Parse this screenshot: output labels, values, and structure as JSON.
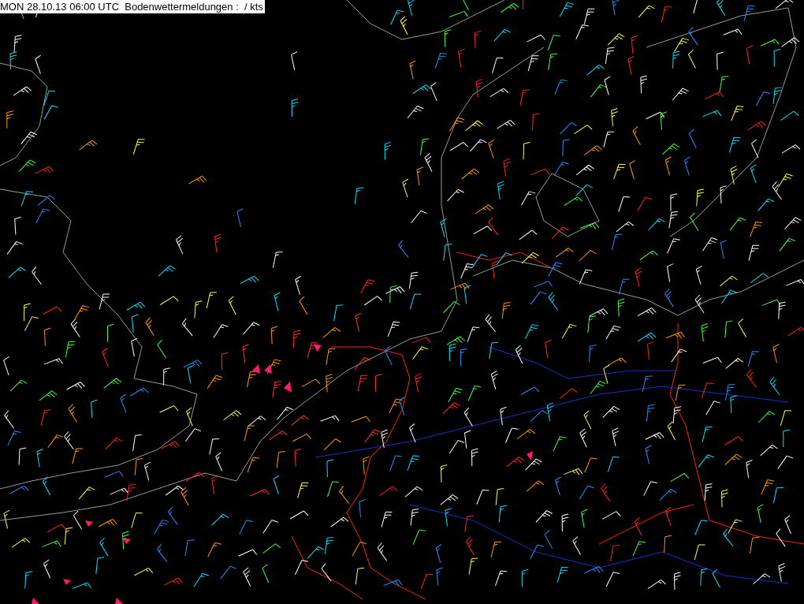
{
  "map_title": {
    "text": "MON 28.10.13 06:00 UTC  Bodenwettermeldungen :  / kts"
  }
}
